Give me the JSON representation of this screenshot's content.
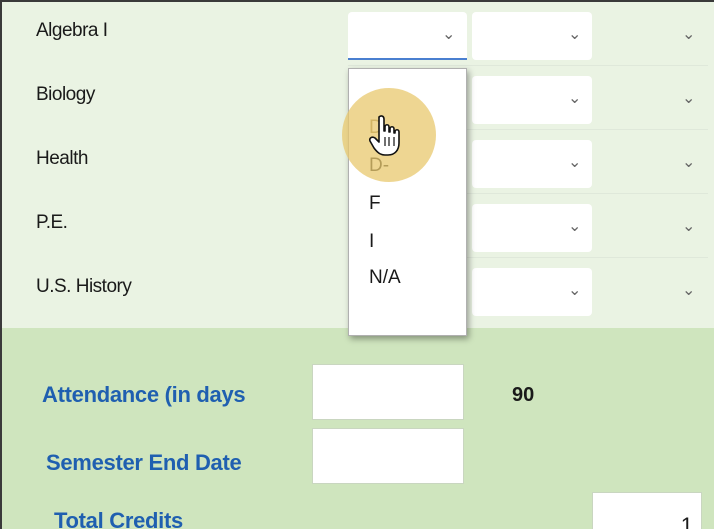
{
  "courses": [
    {
      "name": "Algebra I"
    },
    {
      "name": "Biology"
    },
    {
      "name": "Health"
    },
    {
      "name": "P.E."
    },
    {
      "name": "U.S. History"
    }
  ],
  "dropdown": {
    "options": [
      "D",
      "D-",
      "F",
      "I",
      "N/A"
    ],
    "hovered": "D"
  },
  "summary": {
    "attendance_label": "Attendance (in days",
    "attendance_value": "90",
    "semester_end_label": "Semester End Date",
    "total_credits_label": "Total Credits",
    "total_credits_value": "1"
  },
  "icons": {
    "chevron": "chevron-down-icon",
    "cursor": "hand-pointer-icon"
  },
  "colors": {
    "course_bg": "#eaf3e3",
    "summary_bg": "#cfe5be",
    "label_blue": "#1f5fb0",
    "focus_underline": "#4a7fd0",
    "cursor_halo": "#e8c86e"
  }
}
